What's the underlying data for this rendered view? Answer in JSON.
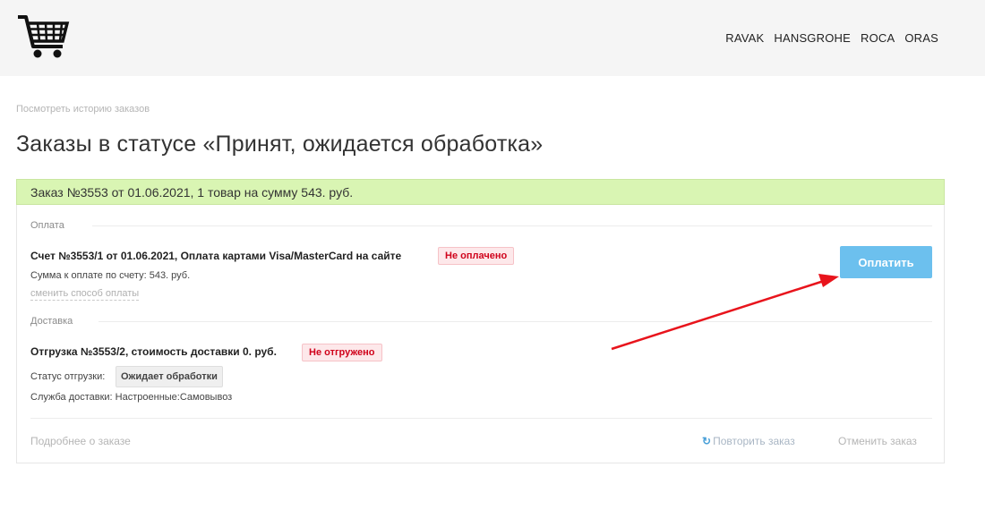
{
  "header": {
    "logo_icon": "shopping-cart-icon",
    "brands": [
      "RAVAK",
      "HANSGROHE",
      "ROCA",
      "ORAS"
    ]
  },
  "page": {
    "history_link": "Посмотреть историю заказов",
    "title": "Заказы в статусе «Принят, ожидается обработка»"
  },
  "order": {
    "header": "Заказ №3553 от 01.06.2021, 1 товар на сумму 543. руб.",
    "payment": {
      "section_label": "Оплата",
      "bill_title": "Счет №3553/1 от 01.06.2021, Оплата картами Visa/MasterCard на сайте",
      "status": "Не оплачено",
      "sum_text": "Сумма к оплате по счету: 543. руб.",
      "change_link": "сменить способ оплаты",
      "pay_button": "Оплатить"
    },
    "delivery": {
      "section_label": "Доставка",
      "shipment_title": "Отгрузка №3553/2, стоимость доставки 0. руб.",
      "status": "Не отгружено",
      "status_label": "Статус отгрузки:",
      "status_value": "Ожидает обработки",
      "service_text": "Служба доставки: Настроенные:Самовывоз"
    },
    "footer": {
      "details_link": "Подробнее о заказе",
      "repeat_link": "Повторить заказ",
      "repeat_icon": "refresh-icon",
      "cancel_link": "Отменить заказ"
    }
  },
  "colors": {
    "order_header_bg": "#d9f5b3",
    "pay_button": "#6cc0ee",
    "status_badge_text": "#d0021b",
    "annotation_arrow": "#e8141c"
  }
}
